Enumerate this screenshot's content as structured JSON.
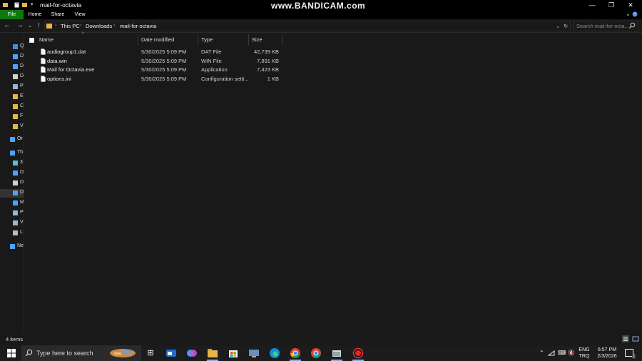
{
  "window": {
    "title": "mail-for-octavia",
    "watermark": "www.BANDICAM.com",
    "controls": [
      "—",
      "❐",
      "✕"
    ]
  },
  "ribbon": {
    "tabs": [
      "File",
      "Home",
      "Share",
      "View"
    ]
  },
  "address": {
    "crumbs": [
      "This PC",
      "Downloads",
      "mail-for-octavia"
    ],
    "search_placeholder": "Search mail-for-octa..."
  },
  "navpane": {
    "items": [
      {
        "label": "Qu",
        "icon": "star-icon",
        "color": "#3b8eea"
      },
      {
        "label": "D",
        "icon": "desktop-icon",
        "color": "#4aa3ff"
      },
      {
        "label": "D",
        "icon": "download-icon",
        "color": "#4aa3ff"
      },
      {
        "label": "D",
        "icon": "document-icon",
        "color": "#d0d0d0"
      },
      {
        "label": "P",
        "icon": "pictures-icon",
        "color": "#8fb7e6"
      },
      {
        "label": "E",
        "icon": "folder-icon",
        "color": "#e8b547"
      },
      {
        "label": "C",
        "icon": "folder-icon",
        "color": "#e8b547"
      },
      {
        "label": "F",
        "icon": "folder-icon",
        "color": "#e8b547"
      },
      {
        "label": "V",
        "icon": "folder-icon",
        "color": "#e8b547"
      },
      {
        "label": "Or",
        "icon": "onedrive-icon",
        "color": "#4aa3ff"
      },
      {
        "label": "Th",
        "icon": "pc-icon",
        "color": "#4aa3ff"
      },
      {
        "label": "3",
        "icon": "cube-icon",
        "color": "#4ac3e6"
      },
      {
        "label": "D",
        "icon": "desktop-icon",
        "color": "#4aa3ff"
      },
      {
        "label": "D",
        "icon": "document-icon",
        "color": "#d0d0d0"
      },
      {
        "label": "D",
        "icon": "download-icon",
        "color": "#4aa3ff"
      },
      {
        "label": "M",
        "icon": "music-icon",
        "color": "#4aa3ff"
      },
      {
        "label": "P",
        "icon": "pictures-icon",
        "color": "#8fb7e6"
      },
      {
        "label": "V",
        "icon": "video-icon",
        "color": "#8fb7e6"
      },
      {
        "label": "L",
        "icon": "drive-icon",
        "color": "#bbbbbb"
      },
      {
        "label": "Ne",
        "icon": "network-icon",
        "color": "#4aa3ff"
      }
    ]
  },
  "columns": {
    "name": "Name",
    "date": "Date modified",
    "type": "Type",
    "size": "Size"
  },
  "files": [
    {
      "name": "audiogroup1.dat",
      "date": "5/30/2025 5:09 PM",
      "type": "DAT File",
      "size": "42,739 KB",
      "icon": "file-icon"
    },
    {
      "name": "data.win",
      "date": "5/30/2025 5:09 PM",
      "type": "WIN File",
      "size": "7,891 KB",
      "icon": "file-icon"
    },
    {
      "name": "Mail for Octavia.exe",
      "date": "5/30/2025 5:09 PM",
      "type": "Application",
      "size": "7,423 KB",
      "icon": "exe-icon"
    },
    {
      "name": "options.ini",
      "date": "5/30/2025 5:09 PM",
      "type": "Configuration setti...",
      "size": "1 KB",
      "icon": "settings-file-icon"
    }
  ],
  "status": {
    "count": "4 items"
  },
  "taskbar": {
    "search_placeholder": "Type here to search",
    "tray": {
      "lang1": "ENG",
      "lang2": "TRQ",
      "time": "6:57 PM",
      "date": "2/3/2026",
      "notifications": "2"
    }
  }
}
